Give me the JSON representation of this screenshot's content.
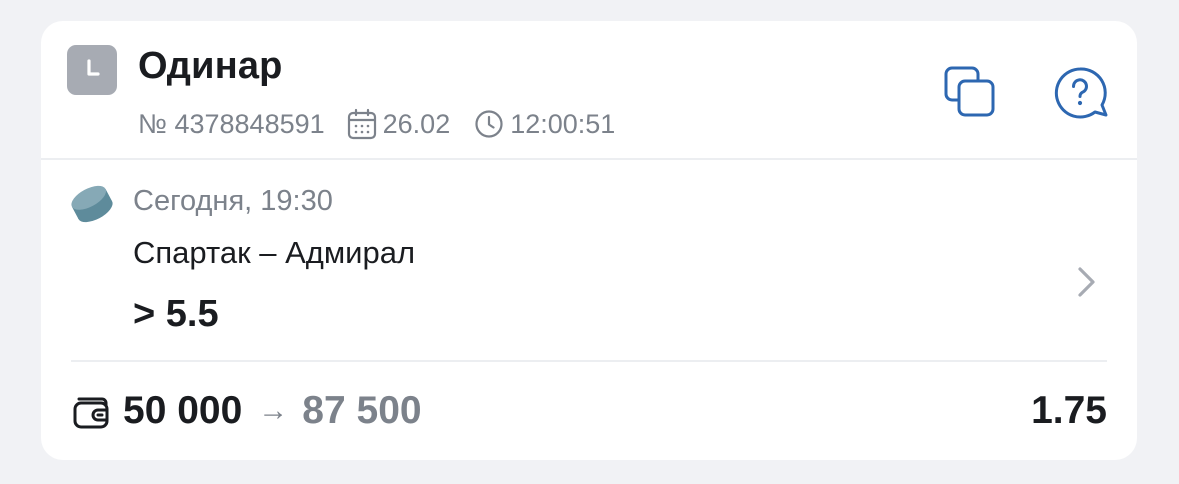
{
  "bet": {
    "type_label": "Одинар",
    "number": "№ 4378848591",
    "date": "26.02",
    "time": "12:00:51",
    "icons": {
      "type": "clock-icon",
      "date": "calendar-icon",
      "time": "clock-icon",
      "copy": "copy-icon",
      "help": "help-bubble-icon"
    }
  },
  "event": {
    "sport_icon": "hockey-puck-icon",
    "time": "Сегодня, 19:30",
    "teams": "Спартак – Адмирал",
    "outcome": "> 5.5"
  },
  "footer": {
    "stake": "50 000",
    "arrow": "→",
    "payout": "87 500",
    "coefficient": "1.75"
  },
  "colors": {
    "accent": "#2d67b1",
    "muted_text": "#7c828b",
    "primary_text": "#1a1c20",
    "icon_gray": "#a7abb3",
    "puck": "#5e8b9b",
    "background": "#f1f2f5"
  }
}
